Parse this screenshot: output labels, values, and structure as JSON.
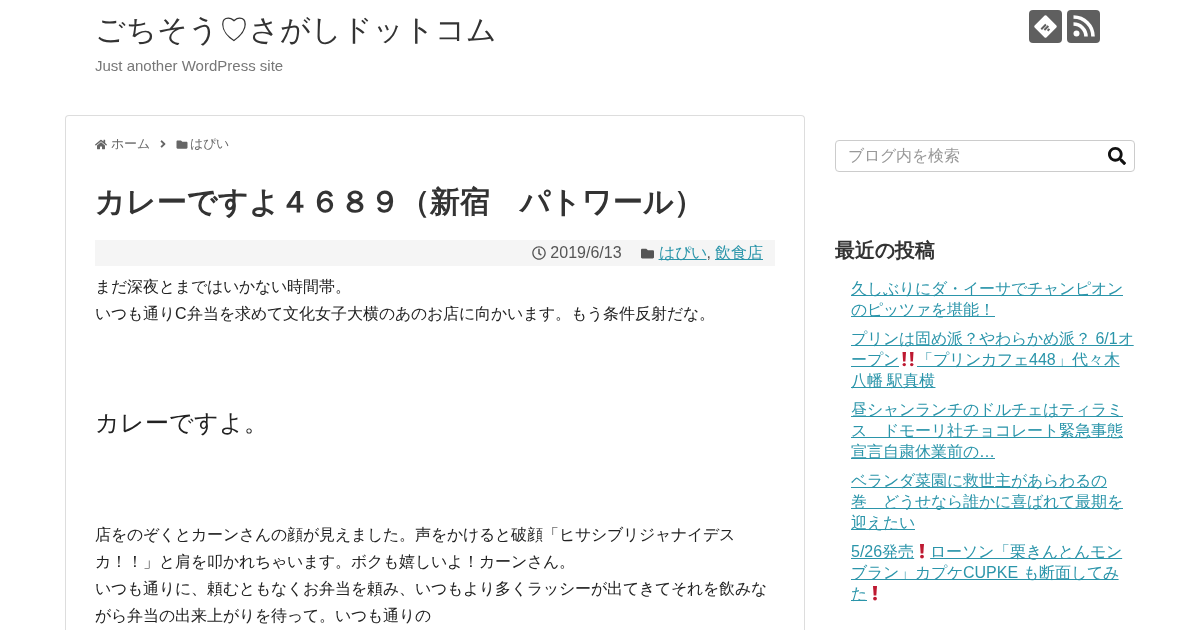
{
  "header": {
    "site_title": "ごちそう♡さがしドットコム",
    "tagline": "Just another WordPress site"
  },
  "breadcrumb": [
    {
      "kind": "home",
      "label": "ホーム"
    },
    {
      "kind": "category",
      "label": "はぴい"
    }
  ],
  "article": {
    "title": "カレーですよ４６８９（新宿　パトワール）",
    "date": "2019/6/13",
    "categories": [
      "はぴい",
      "飲食店"
    ],
    "category_separator": ",",
    "body": [
      {
        "kind": "paragraph",
        "lines": [
          "まだ深夜とまではいかない時間帯。",
          "いつも通りC弁当を求めて文化女子大横のあのお店に向かいます。もう条件反射だな。"
        ]
      },
      {
        "kind": "heading",
        "text": "カレーですよ。"
      },
      {
        "kind": "paragraph",
        "lines": [
          "店をのぞくとカーンさんの顔が見えました。声をかけると破顔「ヒサシブリジャナイデスカ！！」と肩を叩かれちゃいます。ボクも嬉しいよ！カーンさん。",
          "いつも通りに、頼むともなくお弁当を頼み、いつもより多くラッシーが出てきてそれを飲みながら弁当の出来上がりを待って。いつも通りの"
        ]
      }
    ]
  },
  "sidebar": {
    "search": {
      "placeholder": "ブログ内を検索"
    },
    "recent_posts": {
      "title": "最近の投稿",
      "items": [
        {
          "parts": [
            {
              "kind": "text",
              "text": "久しぶりにダ・イーサでチャンピオンのピッツァを堪能！"
            }
          ]
        },
        {
          "parts": [
            {
              "kind": "text",
              "text": "プリンは固め派？やわらかめ派？ 6/1オープン"
            },
            {
              "kind": "double_exclamation"
            },
            {
              "kind": "text",
              "text": "「プリンカフェ448」代々木八幡 駅真横"
            }
          ]
        },
        {
          "parts": [
            {
              "kind": "text",
              "text": "昼シャンランチのドルチェはティラミス　ドモーリ社チョコレート緊急事態宣言自粛休業前の…"
            }
          ]
        },
        {
          "parts": [
            {
              "kind": "text",
              "text": "ベランダ菜園に救世主があらわるの巻　どうせなら誰かに喜ばれて最期を迎えたい"
            }
          ]
        },
        {
          "parts": [
            {
              "kind": "text",
              "text": "5/26発売"
            },
            {
              "kind": "exclamation"
            },
            {
              "kind": "text",
              "text": "ローソン「栗きんとんモンブラン」カプケCUPKE も断面してみた"
            },
            {
              "kind": "exclamation"
            }
          ]
        }
      ]
    }
  }
}
